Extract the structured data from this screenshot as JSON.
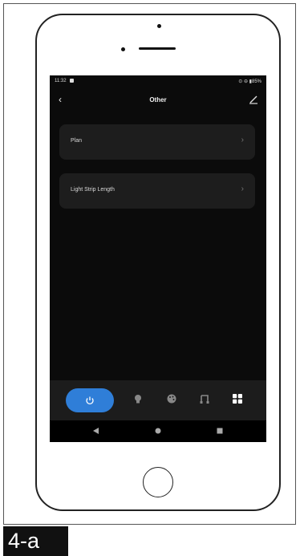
{
  "status_bar": {
    "time": "11:32",
    "right_indicators": "⊙ ⊖ ▮85%"
  },
  "app_bar": {
    "title": "Other",
    "back_icon": "chevron-left-icon",
    "edit_icon": "pencil-icon"
  },
  "menu_items": [
    {
      "label": "Plan"
    },
    {
      "label": "Light Strip Length"
    }
  ],
  "tab_bar": {
    "items": [
      "power-icon",
      "bulb-icon",
      "palette-icon",
      "music-icon",
      "grid-icon"
    ],
    "active": "power-icon",
    "active_color": "#2f7ed8"
  },
  "nav_bar": {
    "items": [
      "back-triangle-icon",
      "home-circle-icon",
      "recents-square-icon"
    ]
  },
  "caption": "4-a"
}
